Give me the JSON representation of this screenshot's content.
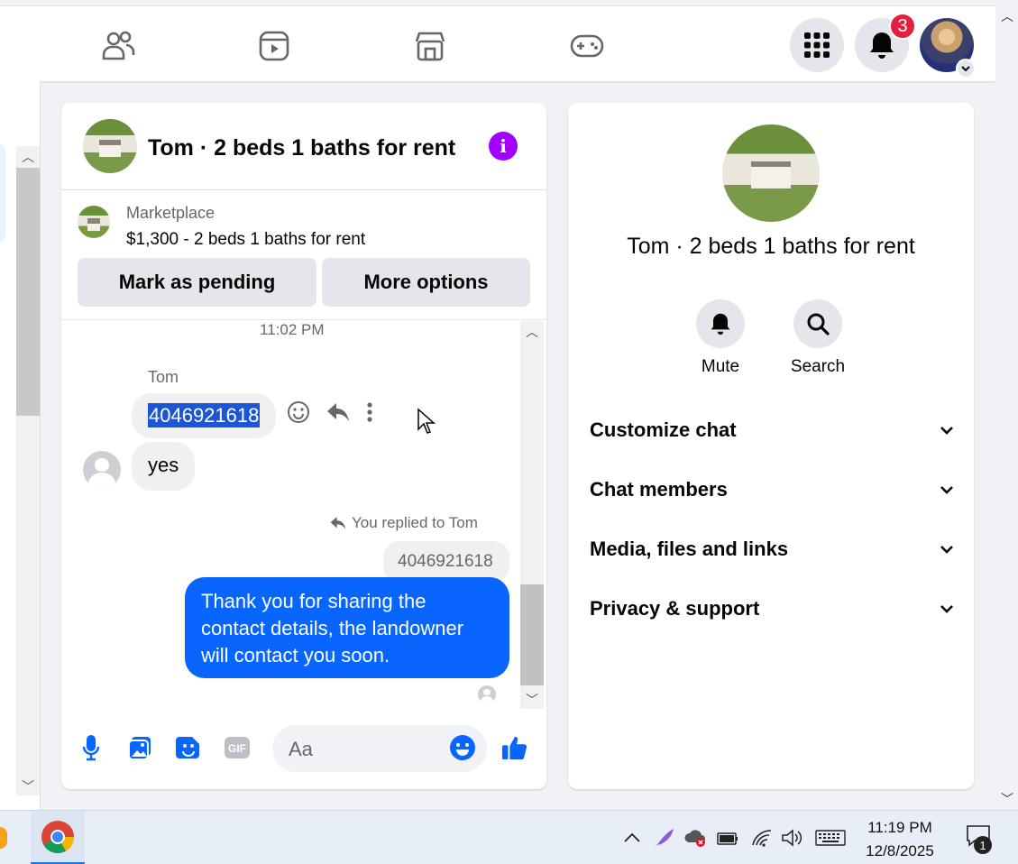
{
  "notifications": {
    "count": "3"
  },
  "chat": {
    "title": "Tom · 2 beds 1 baths for rent",
    "marketplace": {
      "label": "Marketplace",
      "listing": "$1,300 - 2 beds 1 baths for rent",
      "buttons": [
        "Mark as pending",
        "More options"
      ]
    },
    "messages": {
      "timestamp": "11:02 PM",
      "sender": "Tom",
      "phone_message": "4046921618",
      "reply_message": "yes",
      "replied_label": "You replied to Tom",
      "quoted_text": "4046921618",
      "outgoing_text": "Thank you for sharing the contact details, the landowner will contact you soon."
    },
    "composer": {
      "placeholder": "Aa"
    }
  },
  "info_panel": {
    "title": "Tom · 2 beds 1 baths for rent",
    "actions": [
      "Mute",
      "Search"
    ],
    "sections": [
      "Customize chat",
      "Chat members",
      "Media, files and links",
      "Privacy & support"
    ]
  },
  "taskbar": {
    "time": "11:19 PM",
    "date": "12/8/2025",
    "notification_count": "1"
  },
  "colors": {
    "accent": "#0866ff",
    "info_purple": "#a100ff",
    "badge_red": "#e41e3f"
  }
}
